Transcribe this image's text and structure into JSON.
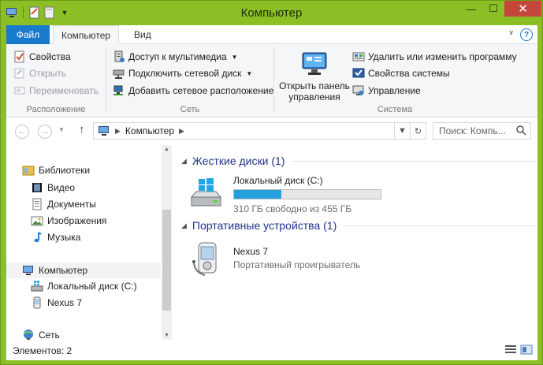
{
  "window": {
    "title": "Компьютер"
  },
  "ribbon_tabs": {
    "file": "Файл",
    "computer": "Компьютер",
    "view": "Вид"
  },
  "ribbon": {
    "location": {
      "label": "Расположение",
      "properties": "Свойства",
      "open": "Открыть",
      "rename": "Переименовать"
    },
    "network": {
      "label": "Сеть",
      "media_access": "Доступ к мультимедиа",
      "map_drive": "Подключить сетевой диск",
      "add_location": "Добавить сетевое расположение"
    },
    "system": {
      "label": "Система",
      "control_panel_line1": "Открыть панель",
      "control_panel_line2": "управления",
      "uninstall": "Удалить или изменить программу",
      "sys_props": "Свойства системы",
      "manage": "Управление"
    }
  },
  "address": {
    "path": "Компьютер",
    "search_placeholder": "Поиск: Компь..."
  },
  "nav": {
    "libraries": "Библиотеки",
    "video": "Видео",
    "documents": "Документы",
    "pictures": "Изображения",
    "music": "Музыка",
    "computer": "Компьютер",
    "local_disk": "Локальный диск (C:)",
    "nexus": "Nexus 7",
    "network": "Сеть"
  },
  "content": {
    "hard_drives_header": "Жесткие диски (1)",
    "drive_name": "Локальный диск (C:)",
    "drive_free": "310 ГБ свободно из 455 ГБ",
    "drive_used_fraction": 0.32,
    "portable_header": "Портативные устройства (1)",
    "device_name": "Nexus 7",
    "device_type": "Портативный проигрыватель"
  },
  "status": {
    "items": "Элементов: 2"
  },
  "colors": {
    "accent": "#1979ca",
    "titlebar": "#8cbf26",
    "progress": "#26a0da",
    "close": "#c7463b"
  }
}
